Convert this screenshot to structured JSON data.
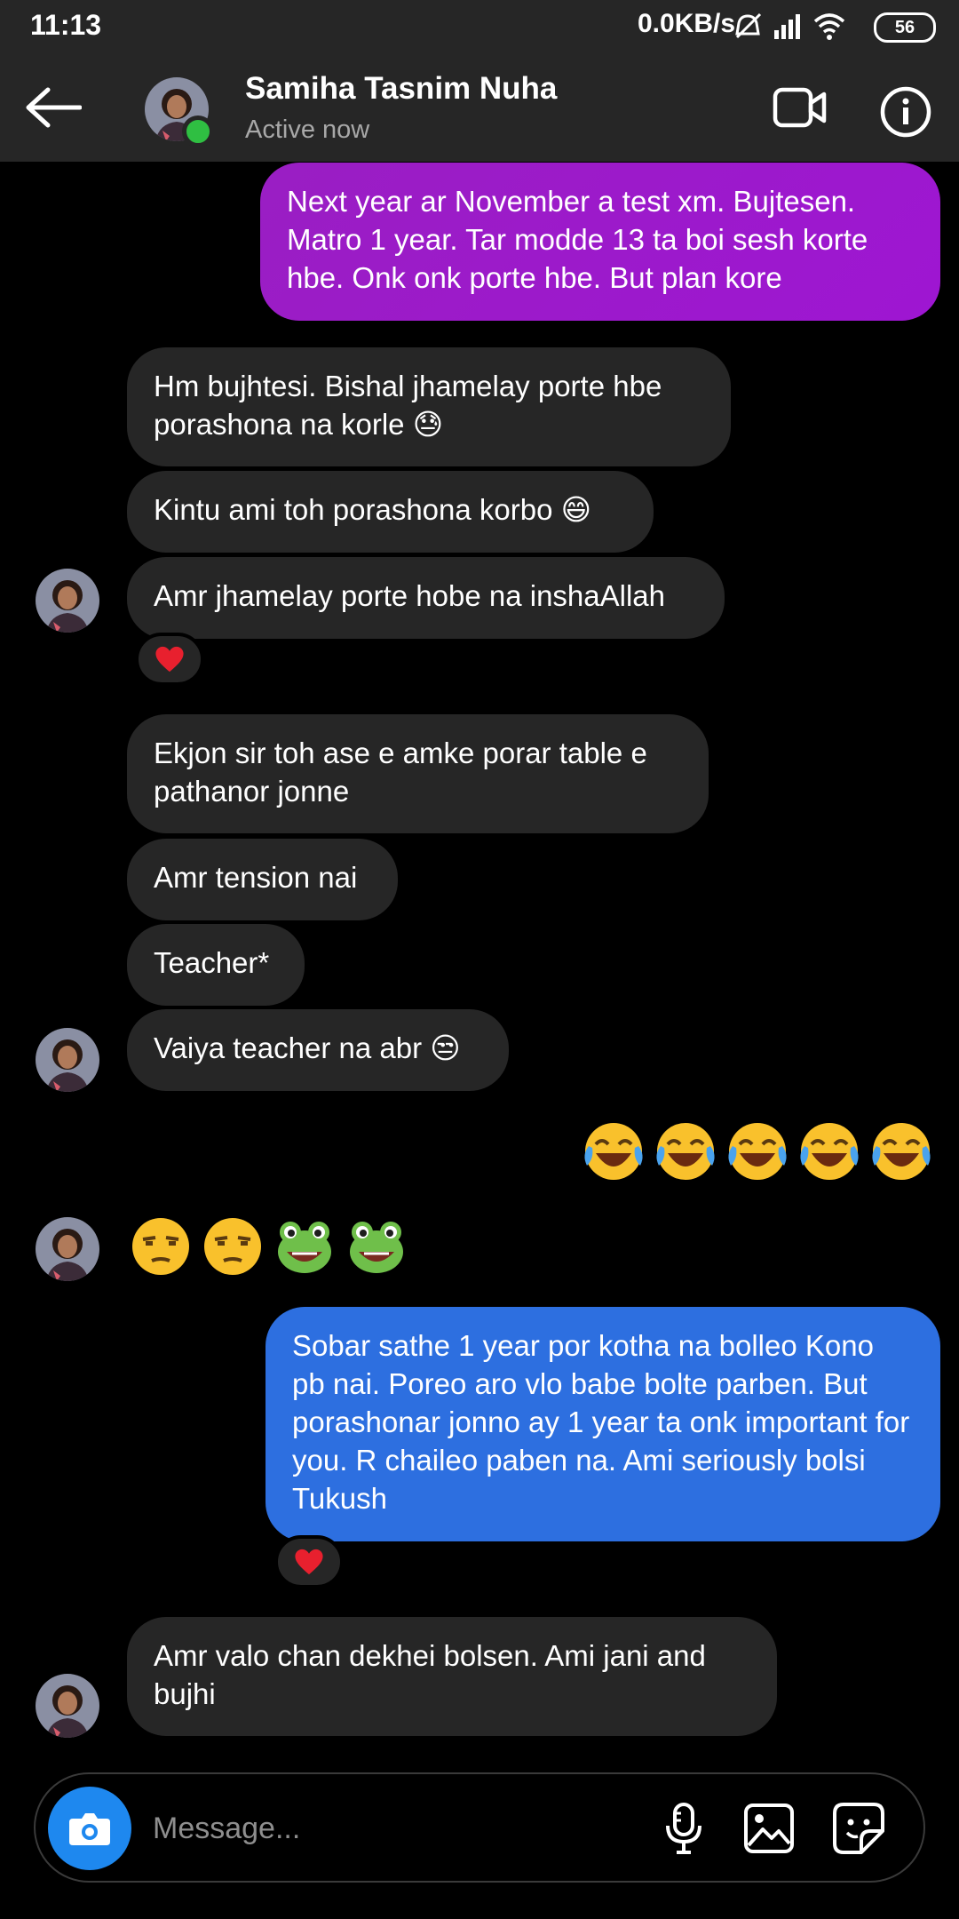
{
  "status_bar": {
    "time": "11:13",
    "network_speed": "0.0KB/s",
    "battery": "56",
    "icons": [
      "mute-icon",
      "signal-icon",
      "wifi-icon",
      "battery-icon"
    ]
  },
  "header": {
    "name": "Samiha Tasnim Nuha",
    "status": "Active now",
    "icons": [
      "back-arrow-icon",
      "video-call-icon",
      "info-icon"
    ]
  },
  "messages": [
    {
      "from": "me",
      "text": "Next year ar November a test xm. Bujtesen. Matro 1 year. Tar modde 13 ta boi sesh korte hbe. Onk onk porte hbe. But plan kore"
    },
    {
      "from": "them",
      "text": "Hm bujhtesi. Bishal jhamelay porte hbe porashona na korle 😓"
    },
    {
      "from": "them",
      "text": "Kintu ami toh porashona korbo 😄"
    },
    {
      "from": "them",
      "text": "Amr jhamelay porte hobe na inshaAllah",
      "reaction": "❤️"
    },
    {
      "from": "them",
      "text": "Ekjon sir toh ase e amke porar table e pathanor jonne"
    },
    {
      "from": "them",
      "text": "Amr tension nai"
    },
    {
      "from": "them",
      "text": "Teacher*"
    },
    {
      "from": "them",
      "text": "Vaiya teacher na abr 😒"
    },
    {
      "from": "me",
      "text": "😂😂😂😂😂"
    },
    {
      "from": "them",
      "text": "😒😒🐸🐸"
    },
    {
      "from": "me",
      "text": "Sobar sathe 1 year por kotha na bolleo Kono pb nai. Poreo aro vlo babe bolte parben. But porashonar jonno ay 1 year ta onk important for you. R chaileo paben na. Ami seriously bolsi Tukush",
      "reaction": "❤️"
    },
    {
      "from": "them",
      "text": "Amr valo chan dekhei bolsen. Ami jani and bujhi"
    }
  ],
  "composer": {
    "placeholder": "Message...",
    "icons": [
      "camera-icon",
      "microphone-icon",
      "gallery-icon",
      "sticker-icon"
    ]
  },
  "colors": {
    "bar": "#262626",
    "incoming": "#262626",
    "outgoing_purple": "#9a1ec3",
    "outgoing_blue": "#2d6fe0",
    "online": "#2fbf42",
    "camera": "#1e88ef"
  }
}
